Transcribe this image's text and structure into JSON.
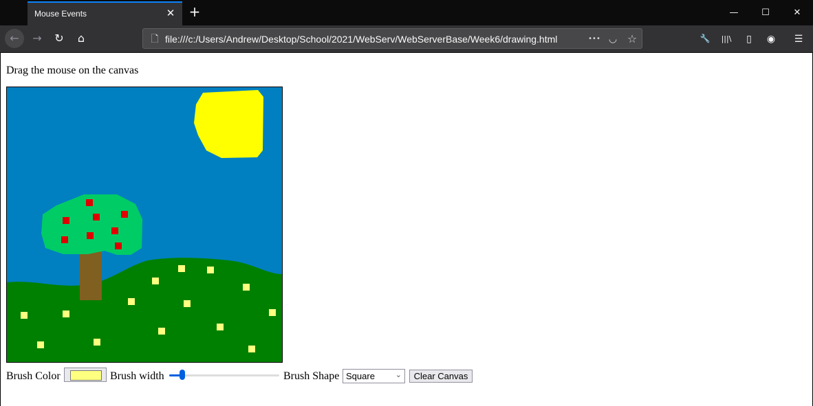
{
  "browser": {
    "tab_title": "Mouse Events",
    "url": "file:///c:/Users/Andrew/Desktop/School/2021/WebServ/WebServerBase/Week6/drawing.html",
    "icons": {
      "tab_close": "close-icon",
      "new_tab": "plus-icon",
      "back": "back-arrow-icon",
      "forward": "forward-arrow-icon",
      "reload": "reload-icon",
      "home": "home-icon",
      "page": "page-icon",
      "more": "ellipsis-icon",
      "pocket": "pocket-icon",
      "bookmark": "star-icon",
      "tools": "wrench-icon",
      "library": "library-icon",
      "sidebar": "sidebar-icon",
      "account": "account-icon",
      "menu": "hamburger-icon"
    },
    "glyphs": {
      "close": "✕",
      "plus": "+",
      "minimize": "—",
      "maximize": "☐",
      "window_close": "✕",
      "back": "←",
      "forward": "→",
      "reload": "↻",
      "home": "⌂",
      "page": "🗋",
      "more": "•••",
      "pocket": "◡",
      "star": "☆",
      "wrench": "🔧",
      "library": "|||\\",
      "sidebar": "▯",
      "account": "◉",
      "menu": "☰"
    },
    "forward_enabled": false
  },
  "page": {
    "intro": "Drag the mouse on the canvas",
    "controls": {
      "brush_color_label": "Brush Color",
      "brush_color_value": "#ffff80",
      "brush_width_label": "Brush width",
      "brush_width_fraction": 0.12,
      "brush_shape_label": "Brush Shape",
      "brush_shape_value": "Square",
      "clear_button": "Clear Canvas"
    },
    "colors": {
      "sky": "#0080c0",
      "sun": "#ffff00",
      "grass": "#008000",
      "treetop": "#00cc66",
      "trunk": "#806020",
      "apple": "#e00000",
      "flower": "#ffff80"
    }
  }
}
